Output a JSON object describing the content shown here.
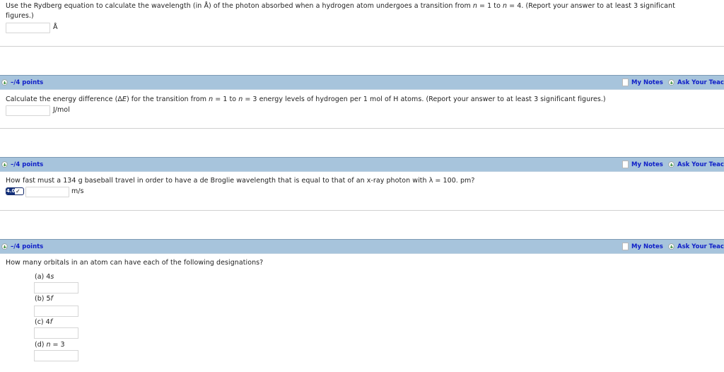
{
  "questions": [
    {
      "text_line1_a": "Use the Rydberg equation to calculate the wavelength (in Å) of the photon absorbed when a hydrogen atom undergoes a transition from ",
      "n": "n",
      "eq1": " = 1 to ",
      "eq2": " = 4. (Report your answer to at least 3 significant",
      "text_line2": "figures.)",
      "answer_value": "",
      "unit": "Å"
    },
    {
      "points": "–/4 points",
      "my_notes": "My Notes",
      "ask_teacher": "Ask Your Teacher",
      "text_a": "Calculate the energy difference (Δ",
      "E": "E",
      "text_b": ") for the transition from ",
      "n": "n",
      "text_c": " = 1 to ",
      "text_d": " = 3 energy levels of hydrogen per 1 mol of H atoms. (Report your answer to at least 3 significant figures.)",
      "answer_value": "",
      "unit": "J/mol"
    },
    {
      "points": "–/4 points",
      "my_notes": "My Notes",
      "ask_teacher": "Ask Your Teacher",
      "text": "How fast must a 134 g baseball travel in order to have a de Broglie wavelength that is equal to that of an x-ray photon with λ = 100. pm?",
      "badge_number": "4.0",
      "badge_check": "✓",
      "answer_value": "",
      "unit": "m/s"
    },
    {
      "points": "–/4 points",
      "my_notes": "My Notes",
      "ask_teacher": "Ask Your Teacher",
      "text": "How many orbitals in an atom can have each of the following designations?",
      "parts": [
        {
          "label_prefix": "(a) 4",
          "label_italic": "s",
          "label_suffix": "",
          "answer_value": ""
        },
        {
          "label_prefix": "(b) 5",
          "label_italic": "f",
          "label_suffix": "",
          "answer_value": ""
        },
        {
          "label_prefix": "(c) 4",
          "label_italic": "f",
          "label_suffix": "",
          "answer_value": ""
        },
        {
          "label_prefix": "(d) ",
          "label_italic": "n",
          "label_suffix": " = 3",
          "answer_value": ""
        }
      ]
    }
  ]
}
